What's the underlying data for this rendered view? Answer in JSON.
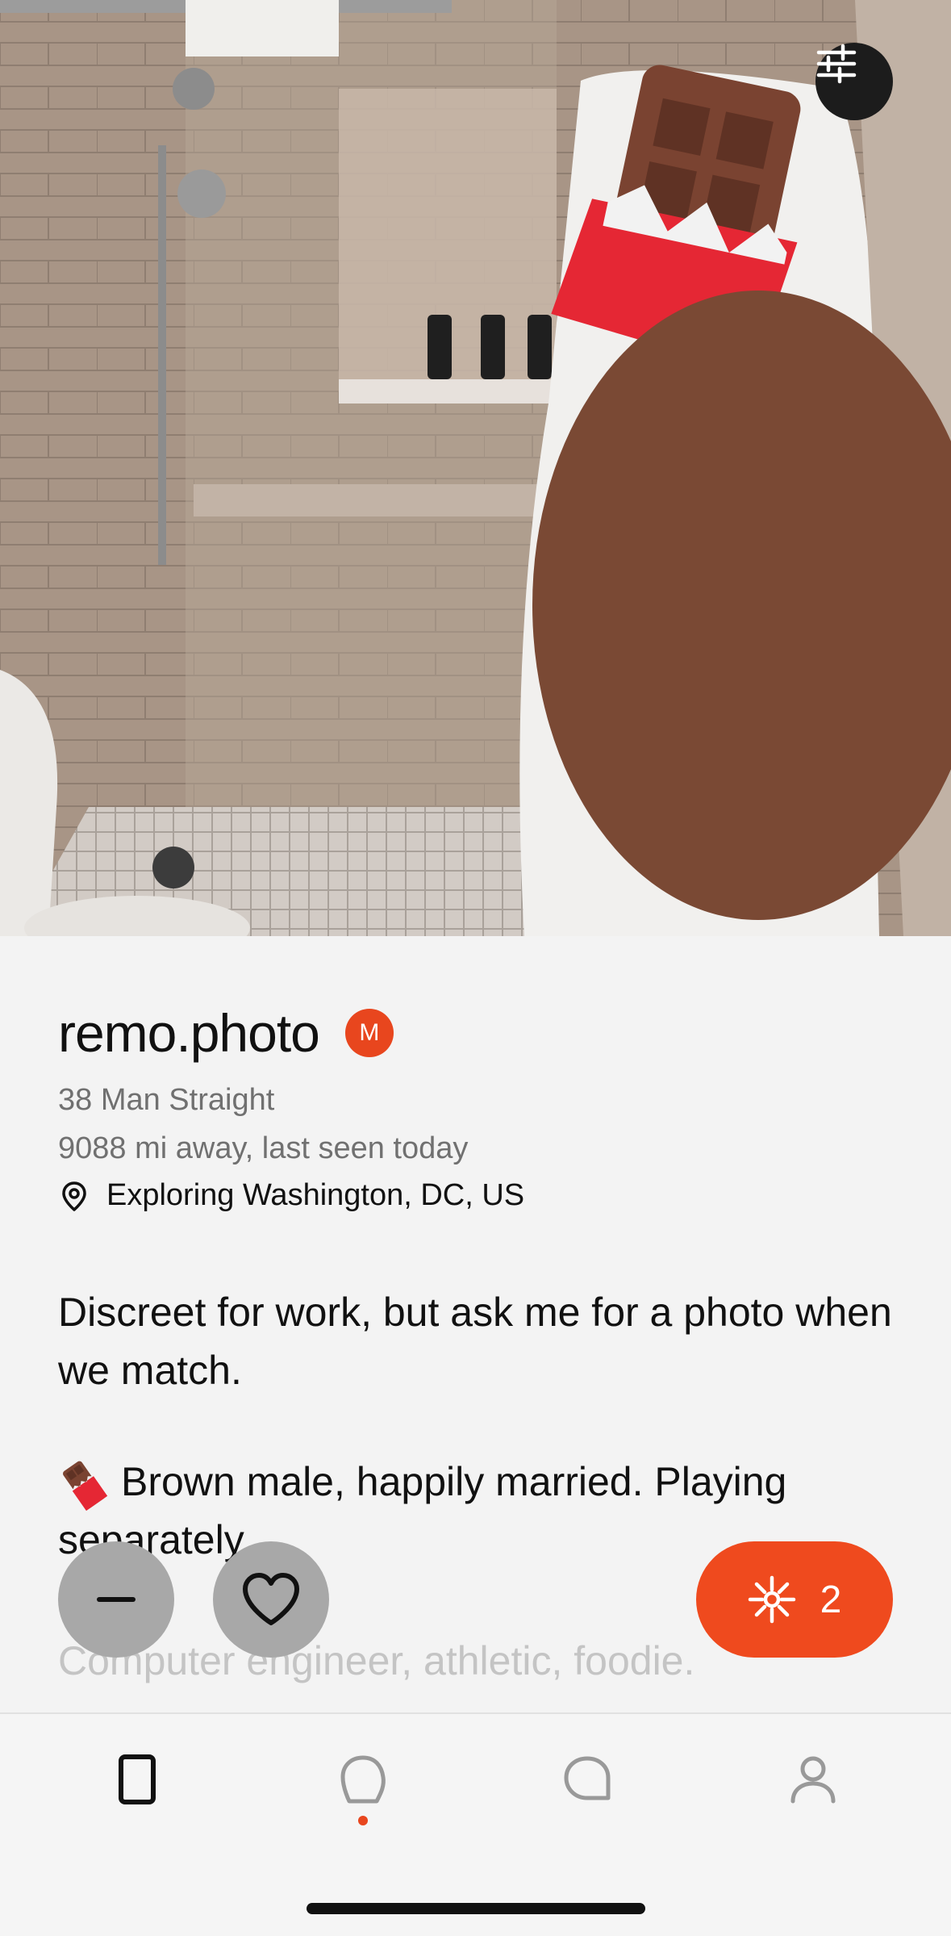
{
  "profile": {
    "name": "remo.photo",
    "badge": "M",
    "age_gender_orientation": "38 Man Straight",
    "distance_seen": "9088 mi away, last seen today",
    "location": "Exploring Washington, DC, US"
  },
  "bio": {
    "paragraph1": "Discreet for work, but ask me for a photo when we match.",
    "paragraph2_emoji": "chocolate-bar",
    "paragraph2": "Brown male, happily married. Playing separately.",
    "paragraph3": "Computer engineer, athletic, foodie."
  },
  "actions": {
    "spark_count": "2"
  },
  "icons": {
    "filter": "sliders-icon",
    "pass": "minus-icon",
    "like": "heart-icon",
    "spark": "sparkle-icon",
    "location": "location-pin-icon"
  },
  "tabs": [
    {
      "name": "cards",
      "active": true
    },
    {
      "name": "likes",
      "has_notification": true
    },
    {
      "name": "chats"
    },
    {
      "name": "profile"
    }
  ],
  "colors": {
    "accent": "#ef4a1e",
    "background": "#f3f3f3",
    "action_button": "#a8a8a8"
  }
}
